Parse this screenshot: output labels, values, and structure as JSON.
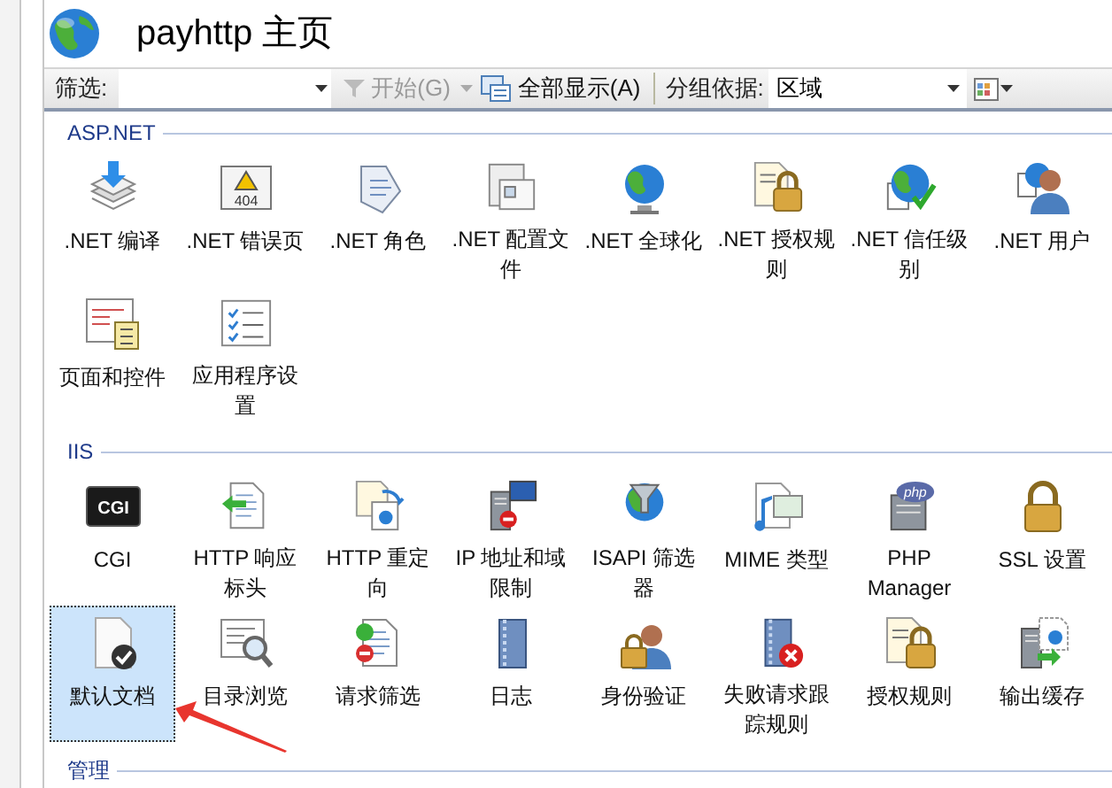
{
  "header": {
    "title": "payhttp 主页"
  },
  "toolbar": {
    "filter_label": "筛选:",
    "start_button": {
      "label": "开始(G)",
      "disabled": true
    },
    "show_all_button": "全部显示(A)",
    "group_label": "分组依据:",
    "group_value": "区域"
  },
  "sections": [
    {
      "title": "ASP.NET",
      "items": [
        {
          "label": ".NET 编译",
          "kind": "stack",
          "selected": false
        },
        {
          "label": ".NET 错误页",
          "kind": "warning",
          "icon_text": "404",
          "selected": false
        },
        {
          "label": ".NET 角色",
          "kind": "tag",
          "selected": false
        },
        {
          "label": ".NET 配置文件",
          "kind": "window",
          "selected": false
        },
        {
          "label": ".NET 全球化",
          "kind": "globe",
          "selected": false
        },
        {
          "label": ".NET 授权规则",
          "kind": "doclock",
          "selected": false
        },
        {
          "label": ".NET 信任级别",
          "kind": "globecheck",
          "selected": false
        },
        {
          "label": ".NET 用户",
          "kind": "user",
          "selected": false
        },
        {
          "label": "页面和控件",
          "kind": "form",
          "selected": false
        },
        {
          "label": "应用程序设置",
          "kind": "checklist",
          "selected": false
        }
      ]
    },
    {
      "title": "IIS",
      "items": [
        {
          "label": "CGI",
          "kind": "cgi",
          "icon_text": "CGI",
          "selected": false
        },
        {
          "label": "HTTP 响应标头",
          "kind": "arrowdoc",
          "selected": false
        },
        {
          "label": "HTTP 重定向",
          "kind": "redirect",
          "selected": false
        },
        {
          "label": "IP 地址和域限制",
          "kind": "server",
          "selected": false
        },
        {
          "label": "ISAPI 筛选器",
          "kind": "funnel",
          "selected": false
        },
        {
          "label": "MIME 类型",
          "kind": "music",
          "selected": false
        },
        {
          "label": "PHP Manager",
          "kind": "php",
          "icon_text": "php",
          "selected": false
        },
        {
          "label": "SSL 设置",
          "kind": "lock",
          "selected": false
        },
        {
          "label": "默认文档",
          "kind": "doccheck",
          "selected": true
        },
        {
          "label": "目录浏览",
          "kind": "magnifier",
          "selected": false
        },
        {
          "label": "请求筛选",
          "kind": "filterdoc",
          "selected": false
        },
        {
          "label": "日志",
          "kind": "notebook",
          "selected": false
        },
        {
          "label": "身份验证",
          "kind": "lockuser",
          "selected": false
        },
        {
          "label": "失败请求跟踪规则",
          "kind": "notebookx",
          "selected": false
        },
        {
          "label": "授权规则",
          "kind": "doclock",
          "selected": false
        },
        {
          "label": "输出缓存",
          "kind": "cache",
          "selected": false
        }
      ]
    },
    {
      "title": "管理"
    }
  ]
}
